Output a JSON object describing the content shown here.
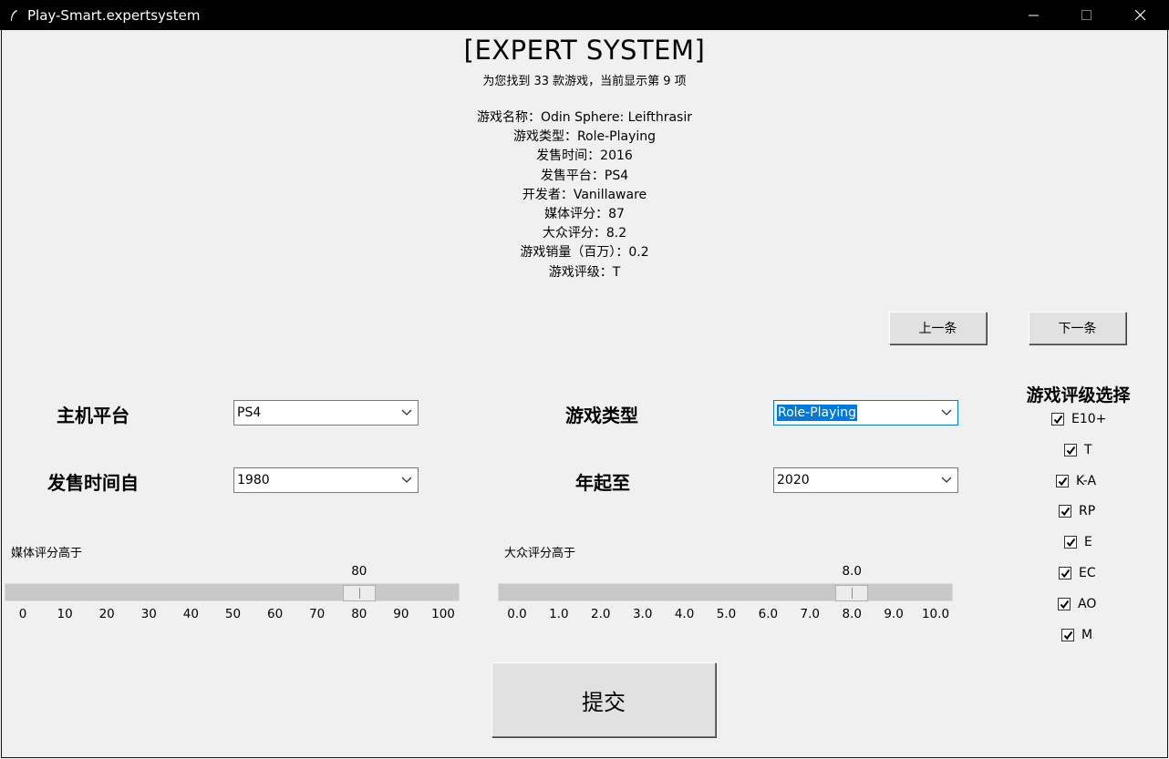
{
  "window": {
    "title": "Play-Smart.expertsystem"
  },
  "header": {
    "title": "[EXPERT SYSTEM]",
    "subtitle": "为您找到 33 款游戏，当前显示第 9 项"
  },
  "game_info": [
    "游戏名称：Odin Sphere: Leifthrasir",
    "游戏类型：Role-Playing",
    "发售时间：2016",
    "发售平台：PS4",
    "开发者：Vanillaware",
    "媒体评分：87",
    "大众评分：8.2",
    "游戏销量（百万）：0.2",
    "游戏评级：T"
  ],
  "nav": {
    "prev_label": "上一条",
    "next_label": "下一条"
  },
  "filters": {
    "platform_label": "主机平台",
    "platform_value": "PS4",
    "genre_label": "游戏类型",
    "genre_value": "Role-Playing",
    "year_from_label": "发售时间自",
    "year_from_value": "1980",
    "year_to_label": "年起至",
    "year_to_value": "2020"
  },
  "media_score": {
    "label": "媒体评分高于",
    "value": "80",
    "min": 0,
    "max": 100,
    "ticks": [
      "0",
      "10",
      "20",
      "30",
      "40",
      "50",
      "60",
      "70",
      "80",
      "90",
      "100"
    ]
  },
  "user_score": {
    "label": "大众评分高于",
    "value": "8.0",
    "min": 0,
    "max": 10,
    "ticks": [
      "0.0",
      "1.0",
      "2.0",
      "3.0",
      "4.0",
      "5.0",
      "6.0",
      "7.0",
      "8.0",
      "9.0",
      "10.0"
    ]
  },
  "ratings": {
    "title": "游戏评级选择",
    "items": [
      {
        "label": "E10+",
        "checked": true
      },
      {
        "label": "T",
        "checked": true
      },
      {
        "label": "K-A",
        "checked": true
      },
      {
        "label": "RP",
        "checked": true
      },
      {
        "label": "E",
        "checked": true
      },
      {
        "label": "EC",
        "checked": true
      },
      {
        "label": "AO",
        "checked": true
      },
      {
        "label": "M",
        "checked": true
      }
    ]
  },
  "submit_label": "提交"
}
